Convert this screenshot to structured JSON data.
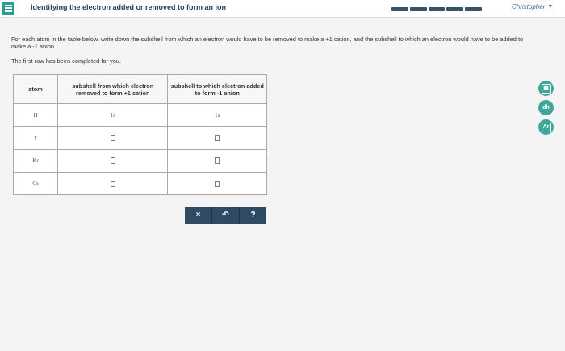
{
  "header": {
    "title": "Identifying the electron added or removed to form an ion",
    "user_name": "Christopher",
    "progress_segments": 5
  },
  "instructions": {
    "text": "For each atom in the table below, write down the subshell from which an electron would have to be removed to make a +1 cation, and the subshell to which an electron would have to be added to make a -1 anion.",
    "note": "The first row has been completed for you."
  },
  "table": {
    "headers": {
      "atom": "atom",
      "removed": "subshell from which electron removed to form +1 cation",
      "added": "subshell to which electron added to form -1 anion"
    },
    "rows": [
      {
        "atom": "H",
        "removed": "1s",
        "added": "1s"
      },
      {
        "atom": "Y",
        "removed": "",
        "added": ""
      },
      {
        "atom": "Kr",
        "removed": "",
        "added": ""
      },
      {
        "atom": "Cs",
        "removed": "",
        "added": ""
      }
    ]
  },
  "actions": {
    "clear": "×",
    "undo": "↶",
    "help": "?"
  },
  "tools": {
    "calculator": "▦",
    "data": "dh",
    "periodic": "Ar"
  },
  "colors": {
    "accent": "#3fa79a",
    "navy": "#2f4b63",
    "title": "#1f3f5c"
  }
}
